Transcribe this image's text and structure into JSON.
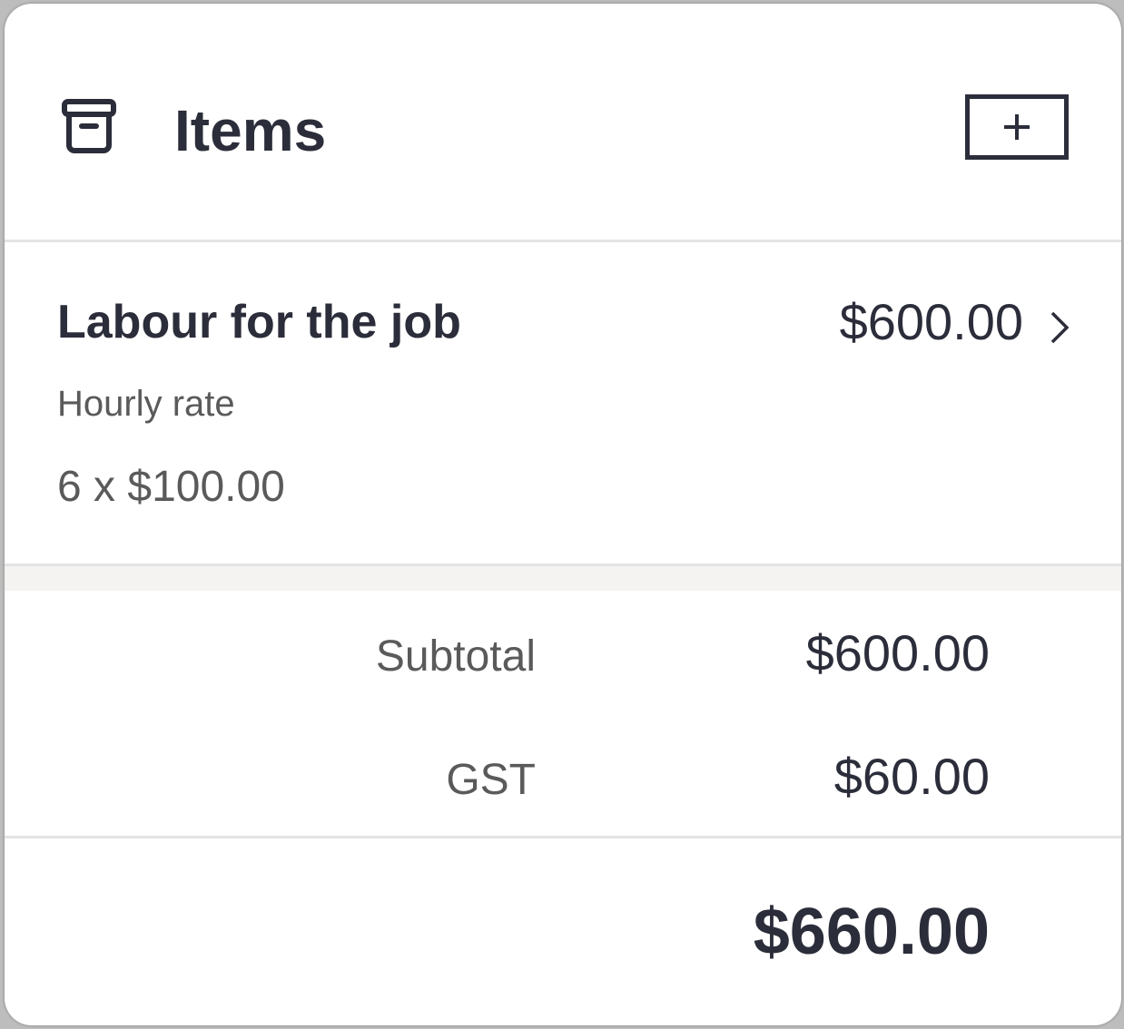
{
  "header": {
    "title": "Items",
    "icon": "archive-box-icon",
    "add_button_icon": "plus-icon"
  },
  "line_items": [
    {
      "name": "Labour for the job",
      "amount": "$600.00",
      "description": "Hourly rate",
      "quantity_rate": "6 x $100.00",
      "chevron_icon": "chevron-right-icon"
    }
  ],
  "totals": {
    "subtotal_label": "Subtotal",
    "subtotal_value": "$600.00",
    "gst_label": "GST",
    "gst_value": "$60.00",
    "grand_total": "$660.00"
  },
  "colors": {
    "text_primary": "#2b2d3a",
    "text_secondary": "#5a5a5a",
    "divider": "#e4e4e4",
    "band": "#f4f3f1"
  }
}
